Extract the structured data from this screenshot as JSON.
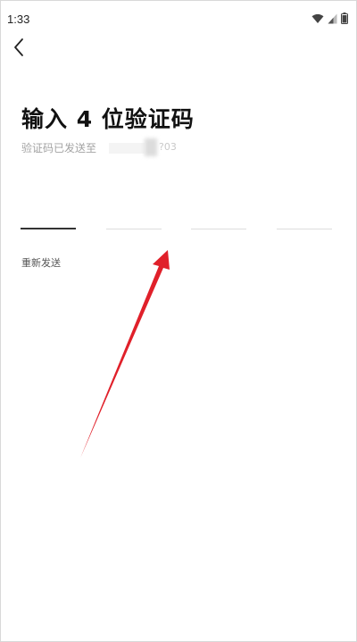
{
  "status_bar": {
    "time": "1:33",
    "icons": [
      "wifi-icon",
      "signal-icon",
      "battery-icon"
    ]
  },
  "header": {
    "back_icon": "chevron-left-icon"
  },
  "main": {
    "title": "输入 4 位验证码",
    "subtitle_prefix": "验证码已发送至",
    "phone_tail": "?03",
    "code_length": 4,
    "code_digits": [
      "",
      "",
      "",
      ""
    ],
    "resend_label": "重新发送"
  },
  "colors": {
    "title": "#111111",
    "subtitle": "#a3a3a3",
    "slot_active": "#333333",
    "slot_inactive": "#dddddd",
    "annotation_arrow": "#e0202a"
  }
}
